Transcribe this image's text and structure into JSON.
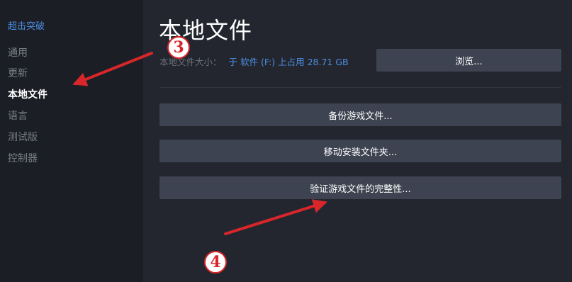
{
  "sidebar": {
    "game_title": "超击突破",
    "items": [
      {
        "label": "通用"
      },
      {
        "label": "更新"
      },
      {
        "label": "本地文件"
      },
      {
        "label": "语言"
      },
      {
        "label": "测试版"
      },
      {
        "label": "控制器"
      }
    ]
  },
  "main": {
    "title": "本地文件",
    "size_label": "本地文件大小：",
    "size_value": "于 软件 (F:) 上占用 28.71 GB",
    "browse_label": "浏览...",
    "backup_label": "备份游戏文件...",
    "move_label": "移动安装文件夹...",
    "verify_label": "验证游戏文件的完整性..."
  },
  "annotations": {
    "step3": "3",
    "step4": "4",
    "color": "#d8262a"
  },
  "colors": {
    "background": "#23262e",
    "sidebar": "#1b1e25",
    "button": "#3d4350",
    "link": "#4c8ee0"
  }
}
